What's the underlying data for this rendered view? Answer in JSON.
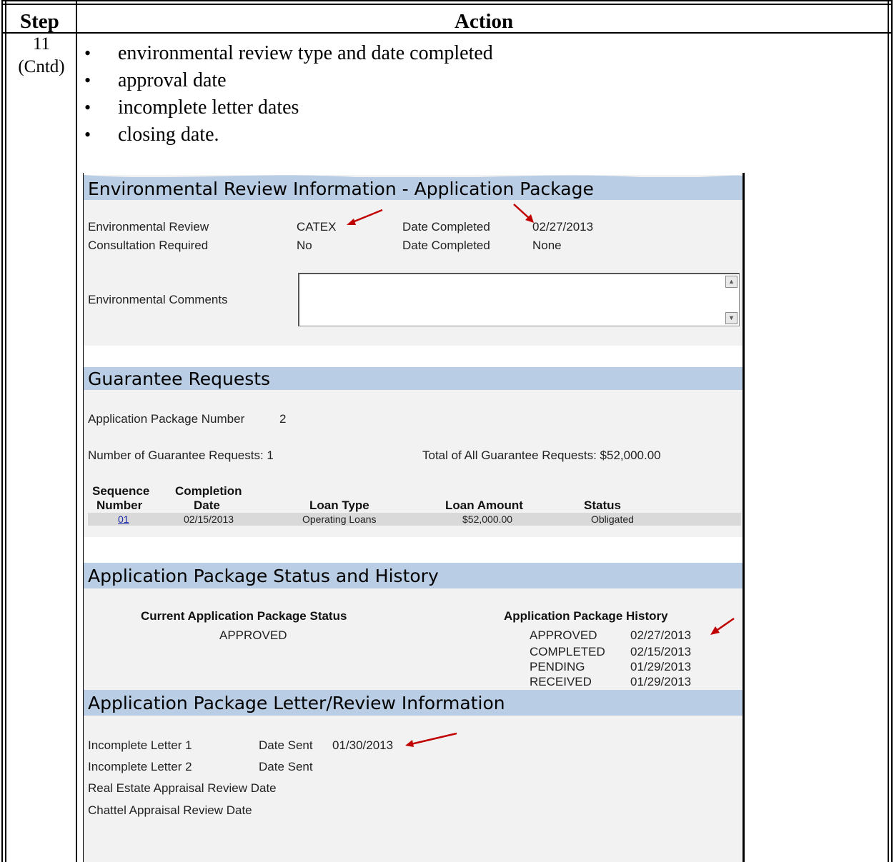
{
  "table": {
    "header_step": "Step",
    "header_action": "Action",
    "step_number": "11",
    "step_cntd": "(Cntd)"
  },
  "bullets": [
    "environmental review type and date completed",
    "approval date",
    "incomplete letter dates",
    "closing date."
  ],
  "env_review": {
    "title": "Environmental Review Information - Application Package",
    "env_review_label": "Environmental Review",
    "env_review_value": "CATEX",
    "date_completed_label": "Date Completed",
    "date_completed_value": "02/27/2013",
    "consultation_label": "Consultation Required",
    "consultation_value": "No",
    "date_completed_label_2": "Date Completed",
    "date_completed_value_2": "None",
    "comments_label": "Environmental Comments",
    "comments_value": ""
  },
  "guarantee": {
    "title": "Guarantee Requests",
    "app_pkg_number_label": "Application Package Number",
    "app_pkg_number_value": "2",
    "num_requests": "Number of Guarantee Requests: 1",
    "total_requests": "Total of All Guarantee Requests: $52,000.00",
    "columns": {
      "seq_1": "Sequence",
      "seq_2": "Number",
      "comp_1": "Completion",
      "comp_2": "Date",
      "loan_type": "Loan Type",
      "loan_amount": "Loan Amount",
      "status": "Status"
    },
    "rows": [
      {
        "seq": "01",
        "date": "02/15/2013",
        "loan_type": "Operating Loans",
        "amount": "$52,000.00",
        "status": "Obligated"
      }
    ]
  },
  "status_history": {
    "title": "Application Package Status and History",
    "current_label": "Current Application Package Status",
    "current_value": "APPROVED",
    "history_label": "Application Package History",
    "history": [
      {
        "status": "APPROVED",
        "date": "02/27/2013"
      },
      {
        "status": "COMPLETED",
        "date": "02/15/2013"
      },
      {
        "status": "PENDING",
        "date": "01/29/2013"
      },
      {
        "status": "RECEIVED",
        "date": "01/29/2013"
      }
    ]
  },
  "letters": {
    "title": "Application Package Letter/Review Information",
    "letter1_label": "Incomplete Letter 1",
    "letter1_sent_label": "Date Sent",
    "letter1_sent_value": "01/30/2013",
    "letter2_label": "Incomplete Letter 2",
    "letter2_sent_label": "Date Sent",
    "real_estate_label": "Real Estate Appraisal Review Date",
    "chattel_label": "Chattel Appraisal Review Date"
  },
  "colors": {
    "band": "#b9cde5",
    "arrow": "#c00000",
    "link": "#1a2aa8"
  }
}
